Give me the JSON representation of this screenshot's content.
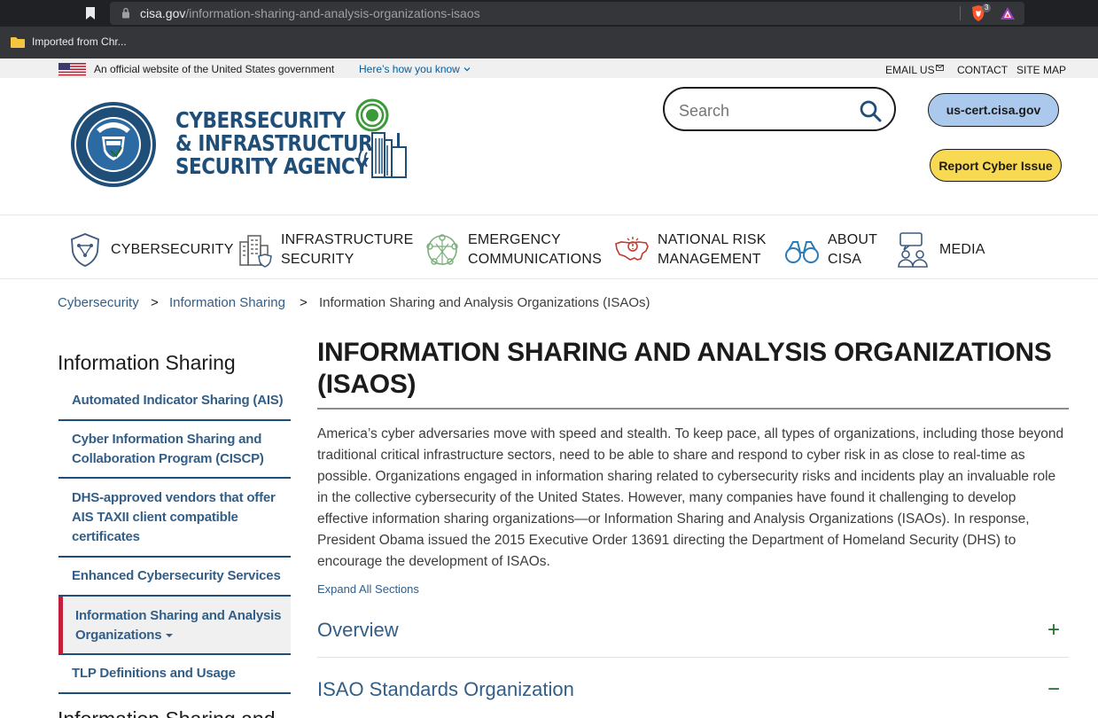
{
  "browser": {
    "url_host": "cisa.gov",
    "url_path": "/information-sharing-and-analysis-organizations-isaos",
    "brave_badge": "3",
    "bookmark_folder": "Imported from Chr..."
  },
  "gov_banner": {
    "official_text": "An official website of the United States government",
    "how_link": "Here’s how you know",
    "email_us": "EMAIL US",
    "contact": "CONTACT",
    "site_map": "SITE MAP"
  },
  "header": {
    "agency_line1": "CYBERSECURITY",
    "agency_line2": "& INFRASTRUCTURE",
    "agency_line3": "SECURITY AGENCY",
    "search_placeholder": "Search",
    "uscert_label": "us-cert.cisa.gov",
    "report_label": "Report Cyber Issue"
  },
  "nav": {
    "cybersecurity": [
      "CYBERSECURITY"
    ],
    "infrastructure": [
      "INFRASTRUCTURE",
      "SECURITY"
    ],
    "emergency": [
      "EMERGENCY",
      "COMMUNICATIONS"
    ],
    "risk": [
      "NATIONAL RISK",
      "MANAGEMENT"
    ],
    "about": [
      "ABOUT",
      "CISA"
    ],
    "media": [
      "MEDIA"
    ]
  },
  "breadcrumb": {
    "item1": "Cybersecurity",
    "item2": "Information Sharing",
    "current": "Information Sharing and Analysis Organizations (ISAOs)",
    "separator": ">"
  },
  "sidebar": {
    "title": "Information Sharing",
    "items": [
      [
        "Automated Indicator Sharing (AIS)"
      ],
      [
        "Cyber Information Sharing and",
        "Collaboration Program (CISCP)"
      ],
      [
        "DHS-approved vendors that offer",
        "AIS TAXII client compatible",
        "certificates"
      ],
      [
        "Enhanced Cybersecurity Services"
      ],
      [
        "Information Sharing and Analysis",
        "Organizations"
      ],
      [
        "TLP Definitions and Usage"
      ]
    ],
    "next_title": "Information Sharing and"
  },
  "main": {
    "title_line1": "INFORMATION SHARING AND ANALYSIS ORGANIZATIONS",
    "title_line2": "(ISAOS)",
    "intro": "America’s cyber adversaries move with speed and stealth. To keep pace, all types of organizations, including those beyond traditional critical infrastructure sectors, need to be able to share and respond to cyber risk in as close to real-time as possible. Organizations engaged in information sharing related to cybersecurity risks and incidents play an invaluable role in the collective cybersecurity of the United States. However, many companies have found it challenging to develop effective information sharing organizations—or Information Sharing and Analysis Organizations (ISAOs). In response, President Obama issued the 2015 Executive Order 13691 directing the Department of Homeland Security (DHS) to encourage the development of ISAOs.",
    "expand_all": "Expand All Sections",
    "sections": [
      {
        "title": "Overview",
        "toggle": "+"
      },
      {
        "title": "ISAO Standards Organization",
        "toggle": "−"
      }
    ]
  }
}
